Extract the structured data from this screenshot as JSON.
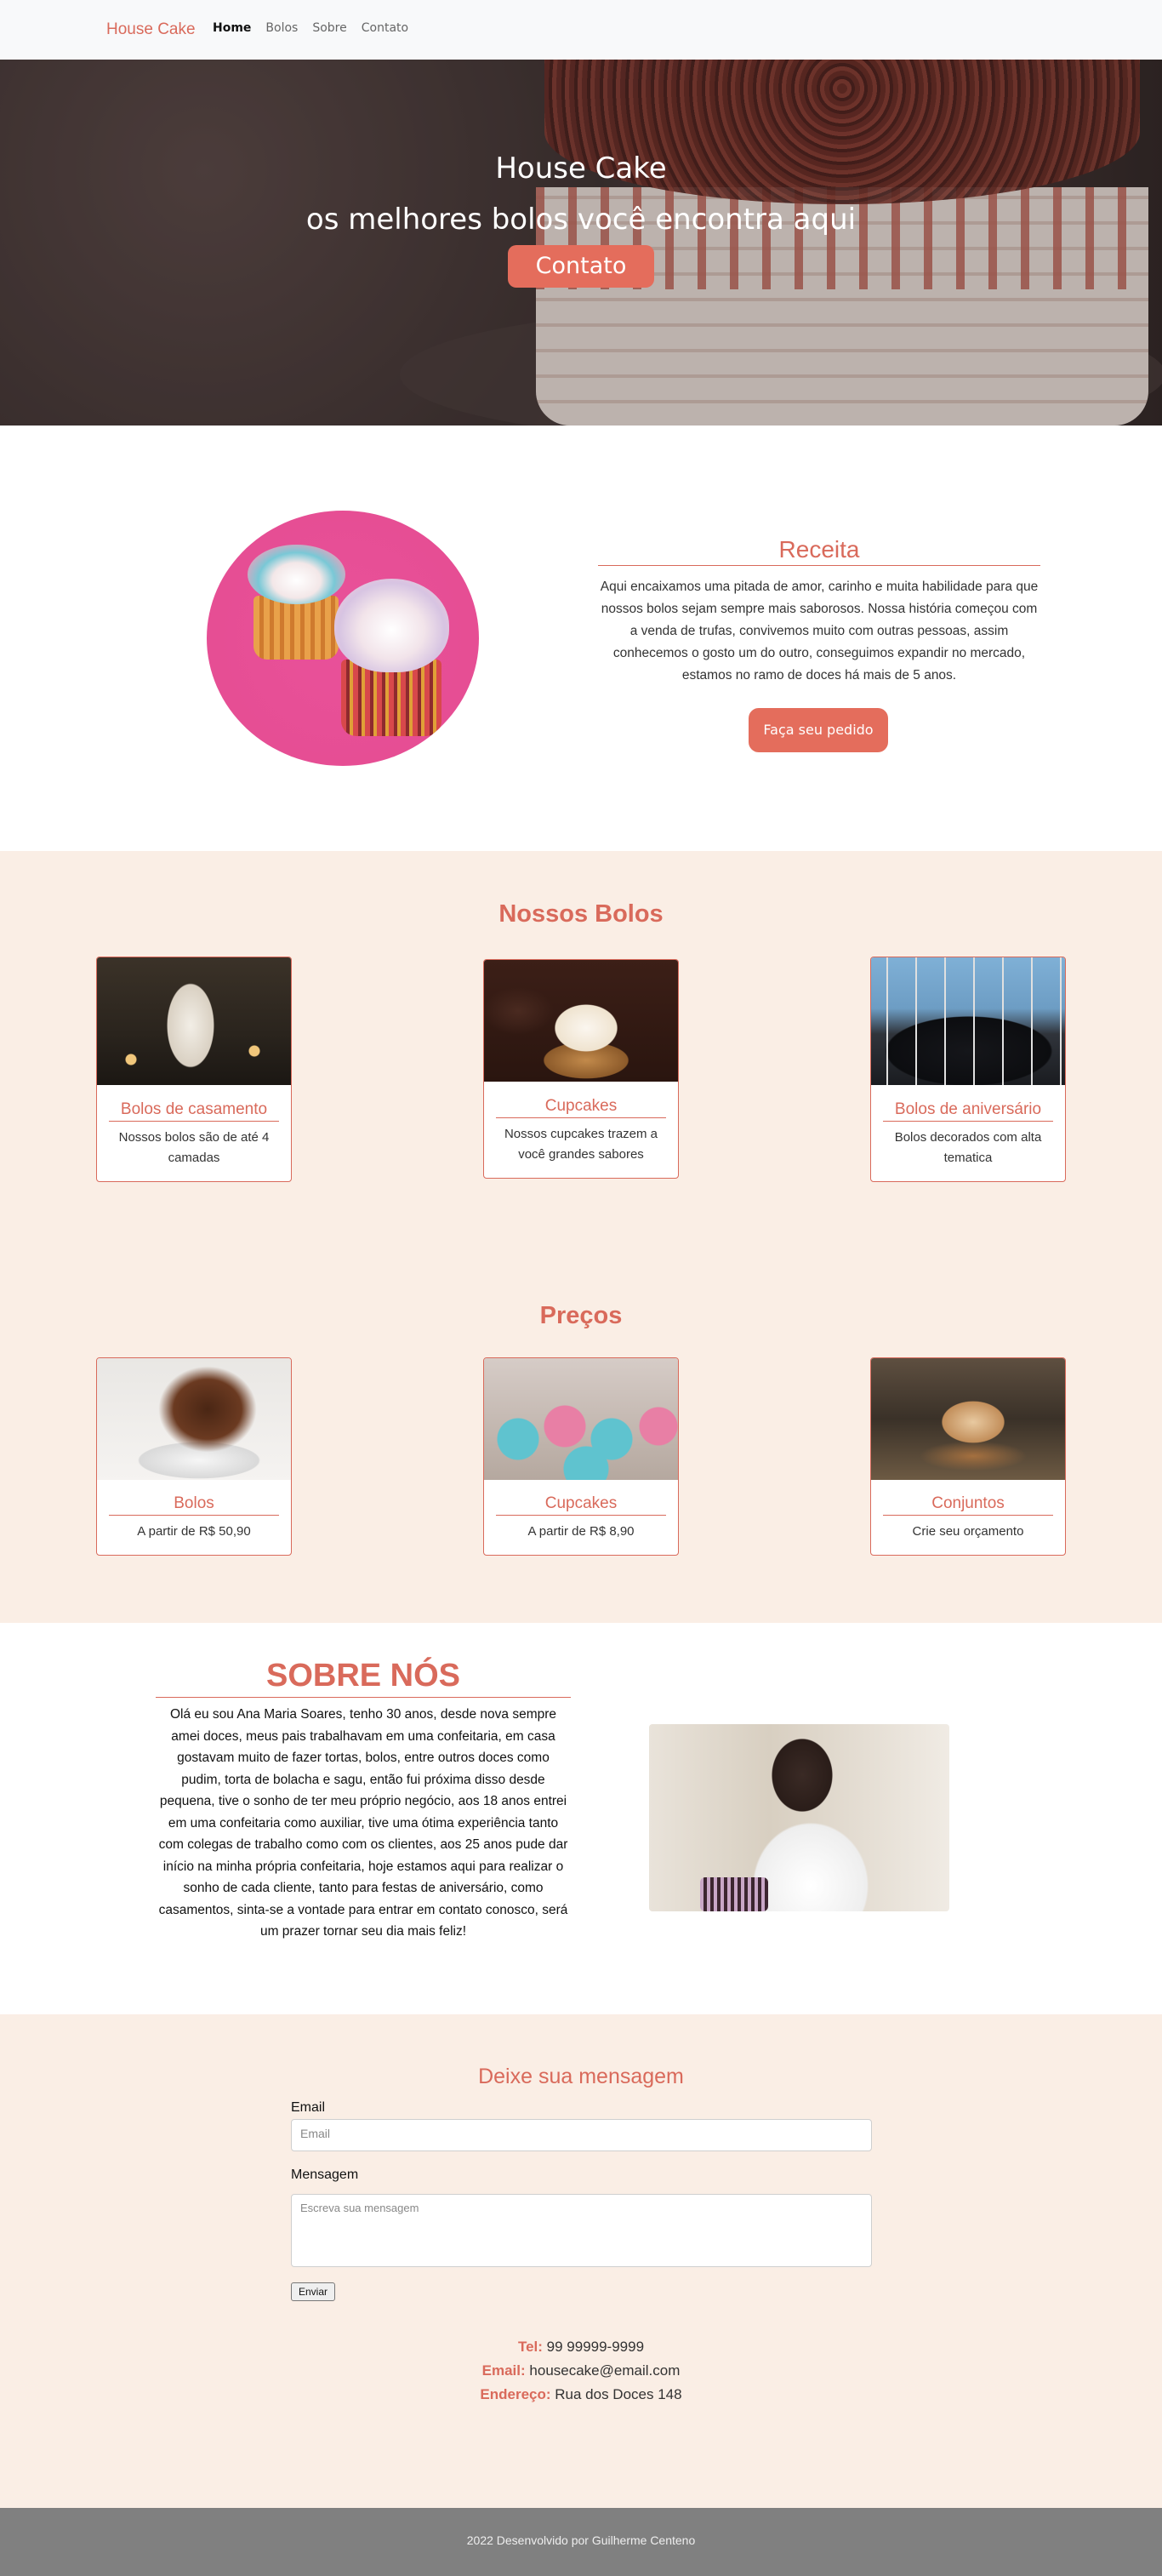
{
  "nav": {
    "brand": "House Cake",
    "links": [
      "Home",
      "Bolos",
      "Sobre",
      "Contato"
    ]
  },
  "hero": {
    "title": "House Cake",
    "subtitle": "os melhores bolos você encontra aqui",
    "button": "Contato"
  },
  "receita": {
    "title": "Receita",
    "text": "Aqui encaixamos uma pitada de amor, carinho e muita habilidade para que nossos bolos sejam sempre mais saborosos. Nossa história começou com a venda de trufas, convivemos muito com outras pessoas, assim conhecemos o gosto um do outro, conseguimos expandir no mercado, estamos no ramo de doces há mais de 5 anos.",
    "button": "Faça seu pedido"
  },
  "bolos": {
    "title": "Nossos Bolos",
    "cards": [
      {
        "title": "Bolos de casamento",
        "text": "Nossos bolos são de até 4 camadas"
      },
      {
        "title": "Cupcakes",
        "text": "Nossos cupcakes trazem a você grandes sabores"
      },
      {
        "title": "Bolos de aniversário",
        "text": "Bolos decorados com alta tematica"
      }
    ]
  },
  "precos": {
    "title": "Preços",
    "cards": [
      {
        "title": "Bolos",
        "text": "A partir de R$ 50,90"
      },
      {
        "title": "Cupcakes",
        "text": "A partir de R$ 8,90"
      },
      {
        "title": "Conjuntos",
        "text": "Crie seu orçamento"
      }
    ]
  },
  "sobre": {
    "title": "SOBRE NÓS",
    "text": "Olá eu sou Ana Maria Soares, tenho 30 anos, desde nova sempre amei doces, meus pais trabalhavam em uma confeitaria, em casa gostavam muito de fazer tortas, bolos, entre outros doces como pudim, torta de bolacha e sagu, então fui próxima disso desde pequena, tive o sonho de ter meu próprio negócio, aos 18 anos entrei em uma confeitaria como auxiliar, tive uma ótima experiência tanto com colegas de trabalho como com os clientes, aos 25 anos pude dar início na minha própria confeitaria, hoje estamos aqui para realizar o sonho de cada cliente, tanto para festas de aniversário, como casamentos, sinta-se a vontade para entrar em contato conosco, será um prazer tornar seu dia mais feliz!"
  },
  "mensagem": {
    "title": "Deixe sua mensagem",
    "email_label": "Email",
    "email_placeholder": "Email",
    "msg_label": "Mensagem",
    "msg_placeholder": "Escreva sua mensagem",
    "send": "Enviar"
  },
  "contato": {
    "tel_label": "Tel:",
    "tel": "99 99999-9999",
    "email_label": "Email:",
    "email": "housecake@email.com",
    "endereco_label": "Endereço:",
    "endereco": "Rua dos Doces 148"
  },
  "footer": {
    "text": "2022 Desenvolvido por Guilherme Centeno"
  },
  "colors": {
    "accent": "#d96a5b",
    "button": "#e46d5c",
    "peach_bg": "#faeee5",
    "footer_bg": "#808080"
  }
}
